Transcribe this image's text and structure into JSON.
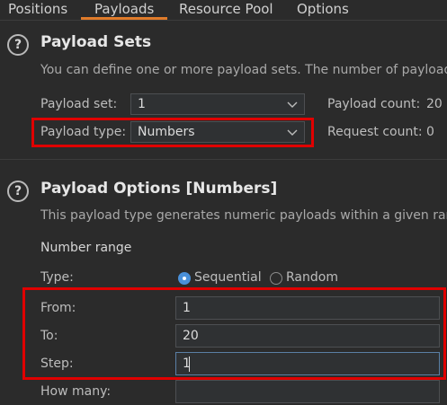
{
  "tabs": [
    {
      "label": "Positions"
    },
    {
      "label": "Payloads"
    },
    {
      "label": "Resource Pool"
    },
    {
      "label": "Options"
    }
  ],
  "payload_sets": {
    "title": "Payload Sets",
    "description": "You can define one or more payload sets. The number of payload",
    "payload_set_label": "Payload set:",
    "payload_set_value": "1",
    "payload_type_label": "Payload type:",
    "payload_type_value": "Numbers",
    "payload_count_label": "Payload count:",
    "payload_count_value": "20",
    "request_count_label": "Request count:",
    "request_count_value": "0"
  },
  "payload_options": {
    "title": "Payload Options [Numbers]",
    "description": "This payload type generates numeric payloads within a given ran",
    "number_range_label": "Number range",
    "type_label": "Type:",
    "sequential_label": "Sequential",
    "random_label": "Random",
    "selected_type": "Sequential",
    "from_label": "From:",
    "from_value": "1",
    "to_label": "To:",
    "to_value": "20",
    "step_label": "Step:",
    "step_value": "1",
    "how_many_label": "How many:",
    "how_many_value": ""
  },
  "colors": {
    "accent_tab": "#e07b2a",
    "highlight": "#e00000",
    "radio_selected": "#4a90d9"
  }
}
